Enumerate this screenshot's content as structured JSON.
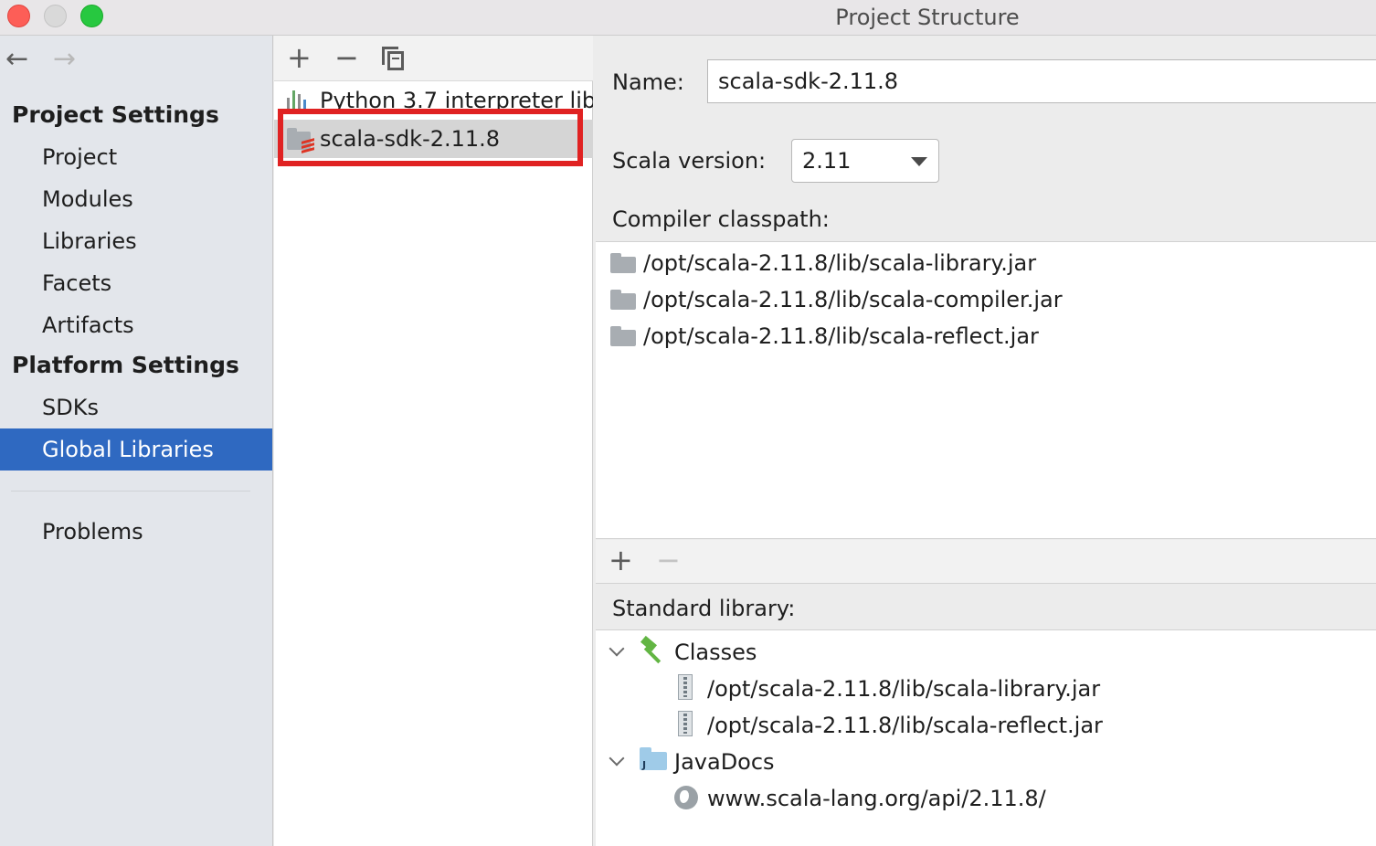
{
  "window": {
    "title": "Project Structure"
  },
  "sidebar": {
    "back_icon": "arrow-left-icon",
    "forward_icon": "arrow-right-icon",
    "project_settings_header": "Project Settings",
    "project_items": [
      {
        "label": "Project"
      },
      {
        "label": "Modules"
      },
      {
        "label": "Libraries"
      },
      {
        "label": "Facets"
      },
      {
        "label": "Artifacts"
      }
    ],
    "platform_settings_header": "Platform Settings",
    "platform_items": [
      {
        "label": "SDKs"
      },
      {
        "label": "Global Libraries",
        "selected": true
      }
    ],
    "problems_label": "Problems",
    "selected_color": "#2f69c1"
  },
  "library_list": {
    "toolbar": {
      "add_label": "+",
      "remove_label": "−",
      "copy_icon": "copy-icon"
    },
    "items": [
      {
        "label": "Python 3.7 interpreter lib",
        "icon": "python-library-icon"
      },
      {
        "label": "scala-sdk-2.11.8",
        "icon": "scala-library-icon",
        "selected": true
      }
    ],
    "highlight_color": "#e02222"
  },
  "details": {
    "name_label": "Name:",
    "name_value": "scala-sdk-2.11.8",
    "scala_version_label": "Scala version:",
    "scala_version_value": "2.11",
    "compiler_classpath_label": "Compiler classpath:",
    "compiler_classpath": [
      "/opt/scala-2.11.8/lib/scala-library.jar",
      "/opt/scala-2.11.8/lib/scala-compiler.jar",
      "/opt/scala-2.11.8/lib/scala-reflect.jar"
    ],
    "classpath_toolbar": {
      "add_label": "+",
      "remove_label": "−"
    },
    "standard_library_label": "Standard library:",
    "standard_library": {
      "classes_label": "Classes",
      "classes": [
        "/opt/scala-2.11.8/lib/scala-library.jar",
        "/opt/scala-2.11.8/lib/scala-reflect.jar"
      ],
      "javadocs_label": "JavaDocs",
      "javadocs": [
        "www.scala-lang.org/api/2.11.8/"
      ]
    }
  }
}
